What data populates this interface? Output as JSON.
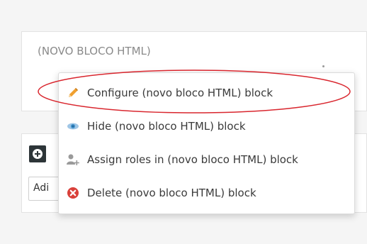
{
  "block": {
    "title": "(NOVO BLOCO HTML)"
  },
  "add_block": {
    "select_text": "Adi"
  },
  "menu": {
    "items": [
      {
        "label": "Configure (novo bloco HTML) block",
        "icon": "pencil-icon"
      },
      {
        "label": "Hide (novo bloco HTML) block",
        "icon": "eye-icon"
      },
      {
        "label": "Assign roles in (novo bloco HTML) block",
        "icon": "assign-roles-icon"
      },
      {
        "label": "Delete (novo bloco HTML) block",
        "icon": "delete-icon"
      }
    ]
  },
  "colors": {
    "highlight": "#d9262e",
    "pencil": "#f0a030",
    "eye": "#3d8ec9",
    "roles": "#9a9a9a",
    "delete": "#d9403a"
  }
}
